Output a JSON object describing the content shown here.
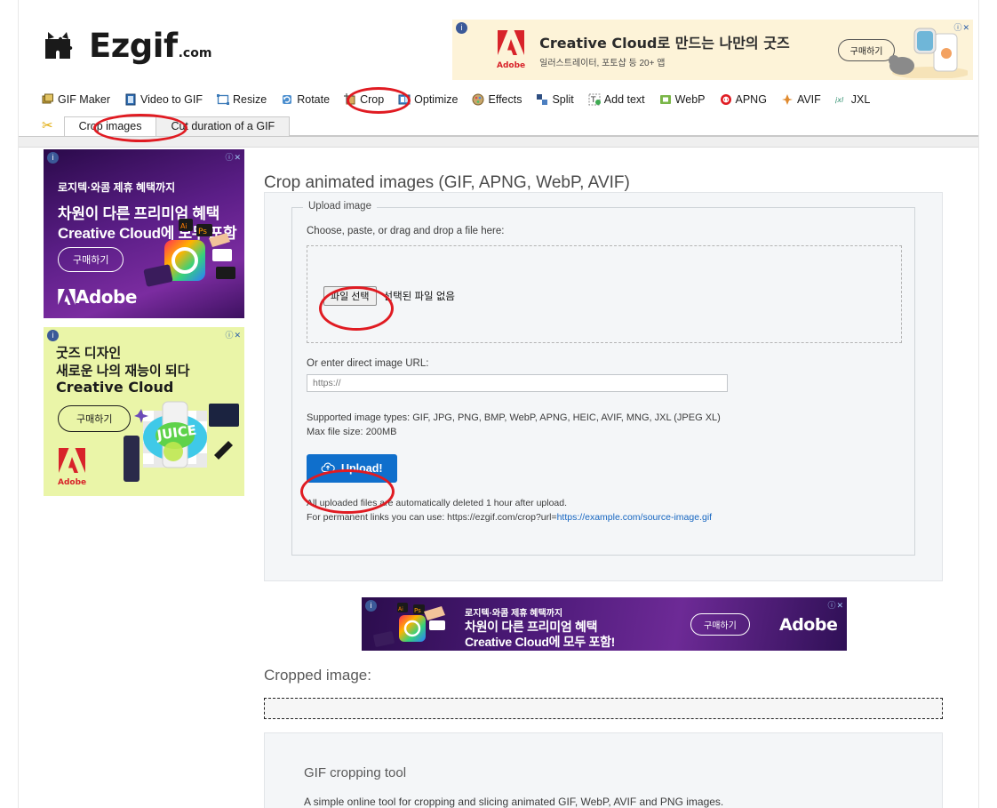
{
  "site": {
    "logo_text": "Ezgif",
    "logo_suffix": ".com",
    "logo_icon": "ezgif-puzzle-logo"
  },
  "nav": {
    "items": [
      {
        "label": "GIF Maker",
        "icon": "gif-maker-icon"
      },
      {
        "label": "Video to GIF",
        "icon": "video-to-gif-icon"
      },
      {
        "label": "Resize",
        "icon": "resize-icon"
      },
      {
        "label": "Rotate",
        "icon": "rotate-icon"
      },
      {
        "label": "Crop",
        "icon": "crop-icon"
      },
      {
        "label": "Optimize",
        "icon": "optimize-icon"
      },
      {
        "label": "Effects",
        "icon": "effects-icon"
      },
      {
        "label": "Split",
        "icon": "split-icon"
      },
      {
        "label": "Add text",
        "icon": "add-text-icon"
      },
      {
        "label": "WebP",
        "icon": "webp-icon"
      },
      {
        "label": "APNG",
        "icon": "apng-icon"
      },
      {
        "label": "AVIF",
        "icon": "avif-icon"
      },
      {
        "label": "JXL",
        "icon": "jxl-icon"
      }
    ]
  },
  "tabs": {
    "scissors_icon": "scissors-icon",
    "items": [
      {
        "label": "Crop images",
        "active": true
      },
      {
        "label": "Cut duration of a GIF",
        "active": false
      }
    ]
  },
  "main": {
    "title": "Crop animated images (GIF, APNG, WebP, AVIF)",
    "fieldset_legend": "Upload image",
    "choose_label": "Choose, paste, or drag and drop a file here:",
    "file_button_label": "파일 선택",
    "file_none_label": "선택된 파일 없음",
    "url_label": "Or enter direct image URL:",
    "url_placeholder": "https://",
    "url_value": "",
    "supported_types": "Supported image types: GIF, JPG, PNG, BMP, WebP, APNG, HEIC, AVIF, MNG, JXL (JPEG XL)",
    "max_file_size": "Max file size: 200MB",
    "upload_button_label": "Upload!",
    "upload_icon": "cloud-upload-icon",
    "note_line1": "All uploaded files are automatically deleted 1 hour after upload.",
    "note_line2_prefix": "For permanent links you can use: https://ezgif.com/crop?url=",
    "note_line2_link": "https://example.com/source-image.gif"
  },
  "bottom": {
    "cropped_title": "Cropped image:",
    "info_heading": "GIF cropping tool",
    "info_paragraph": "A simple online tool for cropping and slicing animated GIF, WebP, AVIF and PNG images."
  },
  "ads": {
    "top": {
      "headline": "Creative Cloud로 만드는 나만의 굿즈",
      "subline": "일러스트레이터, 포토샵 등 20+ 앱",
      "cta": "구매하기",
      "brand": "Adobe",
      "info_icon": "ad-info-icon",
      "close_icon": "ad-close-icon"
    },
    "side1": {
      "line1": "로지텍·와콤 제휴 혜택까지",
      "line2": "차원이 다른 프리미엄 혜택",
      "line3": "Creative Cloud에 모두 포함",
      "cta": "구매하기",
      "brand": "Adobe"
    },
    "side2": {
      "line1": "굿즈 디자인",
      "line2": "새로운 나의 재능이 되다",
      "line3": "Creative Cloud",
      "cta": "구매하기",
      "brand": "Adobe"
    },
    "mid": {
      "line1": "로지텍·와콤 제휴 혜택까지",
      "line2": "차원이 다른 프리미엄 혜택",
      "line3": "Creative Cloud에 모두 포함!",
      "cta": "구매하기",
      "brand": "Adobe"
    }
  },
  "colors": {
    "accent_blue": "#0f6fcc",
    "annotation_red": "#e01b22",
    "panel_bg": "#f4f6f8",
    "link_blue": "#1565c0"
  }
}
